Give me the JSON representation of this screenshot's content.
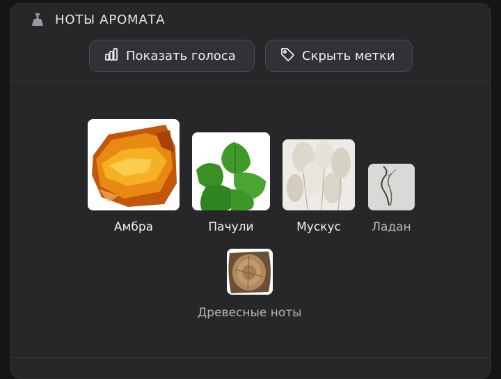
{
  "header": {
    "title": "НОТЫ АРОМАТА",
    "icon": "perfume-bottle-icon"
  },
  "toolbar": {
    "show_votes_label": "Показать голоса",
    "show_votes_icon": "bar-chart-icon",
    "hide_tags_label": "Скрыть метки",
    "hide_tags_icon": "tag-icon"
  },
  "notes": [
    {
      "label": "Амбра",
      "image": "amber-resin"
    },
    {
      "label": "Пачули",
      "image": "patchouli-leaves"
    },
    {
      "label": "Мускус",
      "image": "musk-fluffy-plants"
    },
    {
      "label": "Ладан",
      "image": "incense-smoke"
    },
    {
      "label": "Древесные ноты",
      "image": "wood-log-slice"
    }
  ],
  "colors": {
    "background": "#151517",
    "panel": "#27272a",
    "button": "#323236",
    "text_primary": "#f0f0f2",
    "text_muted": "#b5b5ba"
  }
}
